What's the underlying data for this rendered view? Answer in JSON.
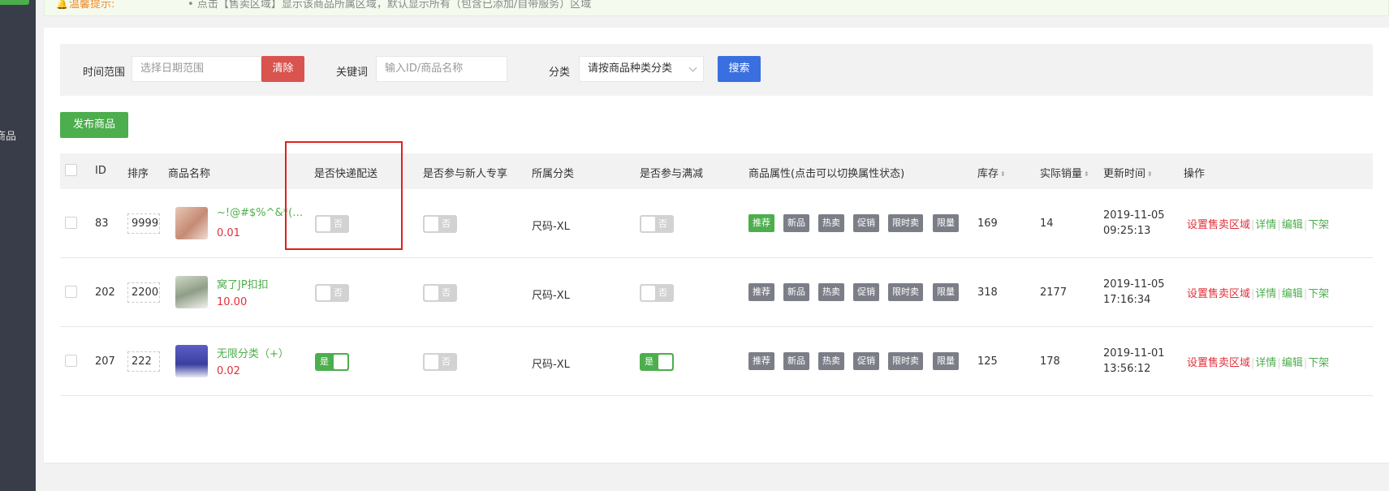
{
  "sidebar": {
    "item_label": "商品"
  },
  "tip": {
    "icon": "bell-icon",
    "title": "温馨提示:",
    "bullet": "•",
    "text": "点击【售卖区域】显示该商品所属区域，默认显示所有（包含已添加/自带服务）区域"
  },
  "filter": {
    "time_label": "时间范围",
    "date_placeholder": "选择日期范围",
    "clear_label": "清除",
    "keyword_label": "关键词",
    "keyword_placeholder": "输入ID/商品名称",
    "category_label": "分类",
    "category_value": "请按商品种类分类",
    "search_label": "搜索"
  },
  "publish_label": "发布商品",
  "table": {
    "headers": {
      "id": "ID",
      "sort": "排序",
      "name": "商品名称",
      "express": "是否快递配送",
      "new_user": "是否参与新人专享",
      "category": "所属分类",
      "full_reduce": "是否参与满减",
      "attrs": "商品属性(点击可以切换属性状态)",
      "stock": "库存",
      "sales": "实际销量",
      "updated": "更新时间",
      "ops": "操作"
    },
    "attr_labels": [
      "推荐",
      "新品",
      "热卖",
      "促销",
      "限时卖",
      "限量"
    ],
    "op_labels": [
      "设置售卖区域",
      "详情",
      "编辑",
      "下架"
    ],
    "rows": [
      {
        "id": "83",
        "sort": "9999",
        "name": "~!@#$%^&*()_+",
        "price": "0.01",
        "express": "否",
        "new_user": "否",
        "category": "尺码-XL",
        "full_reduce": "否",
        "stock": "169",
        "sales": "14",
        "date": "2019-11-05",
        "time": "09:25:13"
      },
      {
        "id": "202",
        "sort": "2200",
        "name": "窝了JP扣扣",
        "price": "10.00",
        "express": "否",
        "new_user": "否",
        "category": "尺码-XL",
        "full_reduce": "否",
        "stock": "318",
        "sales": "2177",
        "date": "2019-11-05",
        "time": "17:16:34"
      },
      {
        "id": "207",
        "sort": "222",
        "name": "无限分类（+）",
        "price": "0.02",
        "express": "是",
        "new_user": "否",
        "category": "尺码-XL",
        "full_reduce": "是",
        "stock": "125",
        "sales": "178",
        "date": "2019-11-01",
        "time": "13:56:12"
      }
    ]
  },
  "colors": {
    "green": "#4cae4c",
    "red": "#d9534f",
    "blue": "#3a6fe0",
    "price": "#e0303a"
  }
}
